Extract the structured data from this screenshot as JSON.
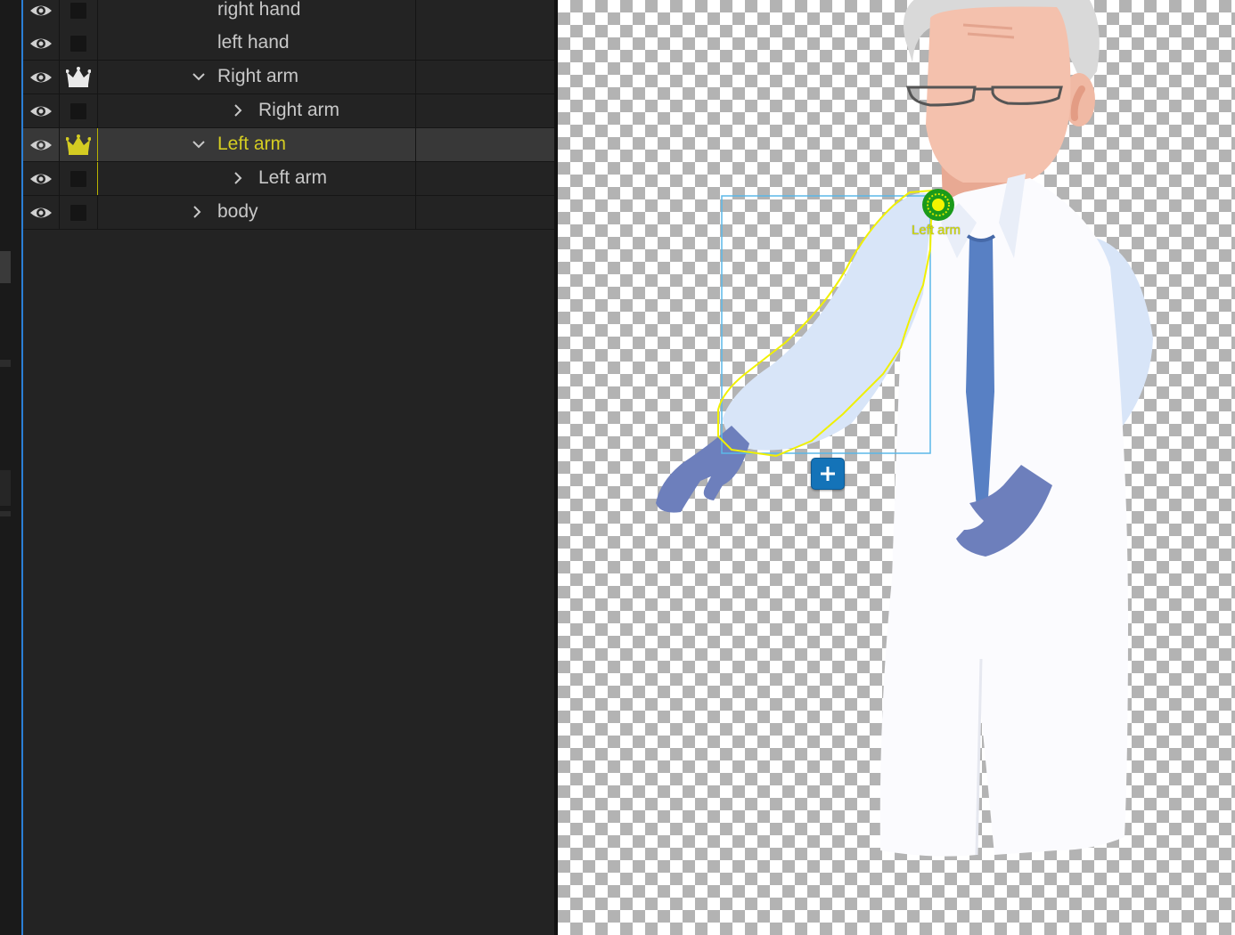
{
  "layers_panel": {
    "rows": [
      {
        "label": "right hand",
        "tag": "none",
        "expander": "none",
        "selected": false
      },
      {
        "label": "left hand",
        "tag": "none",
        "expander": "none",
        "selected": false
      },
      {
        "label": "Right arm",
        "tag": "crown",
        "expander": "expanded",
        "selected": false
      },
      {
        "label": "Right arm",
        "tag": "none",
        "expander": "collapsed",
        "selected": false
      },
      {
        "label": "Left arm",
        "tag": "crown",
        "expander": "expanded",
        "selected": true
      },
      {
        "label": "Left arm",
        "tag": "none",
        "expander": "collapsed",
        "selected": false
      },
      {
        "label": "body",
        "tag": "none",
        "expander": "collapsed",
        "selected": false
      }
    ]
  },
  "canvas": {
    "handle_label": "Left arm",
    "selection_color": "#ffff00",
    "bounds_color": "#5bb8e8",
    "handle_color": "#22aa22"
  },
  "colors": {
    "selected_text": "#d4cc22",
    "text": "#c8c8c8",
    "accent_blue": "#2b7fd6"
  },
  "icons": {
    "visibility": "eye-icon",
    "tag": "crown-icon",
    "add": "plus-icon"
  }
}
